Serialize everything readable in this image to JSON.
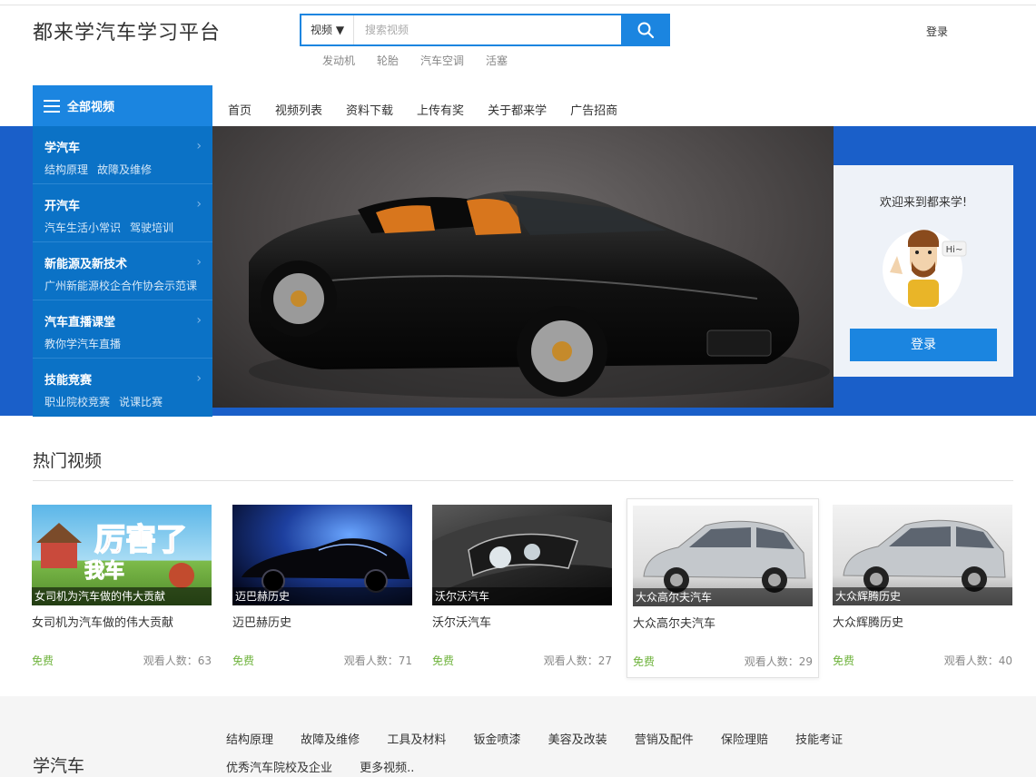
{
  "logo": "都来学汽车学习平台",
  "search": {
    "type_label": "视频 ▼",
    "placeholder": "搜索视频",
    "hot_words": [
      "发动机",
      "轮胎",
      "汽车空调",
      "活塞"
    ]
  },
  "header_login": "登录",
  "all_videos_label": "全部视频",
  "nav": [
    "首页",
    "视频列表",
    "资料下载",
    "上传有奖",
    "关于都来学",
    "广告招商"
  ],
  "side_menu": [
    {
      "title": "学汽车",
      "subs": [
        "结构原理",
        "故障及维修"
      ]
    },
    {
      "title": "开汽车",
      "subs": [
        "汽车生活小常识",
        "驾驶培训"
      ]
    },
    {
      "title": "新能源及新技术",
      "subs": [
        "广州新能源校企合作协会示范课"
      ]
    },
    {
      "title": "汽车直播课堂",
      "subs": [
        "教你学汽车直播"
      ]
    },
    {
      "title": "技能竞赛",
      "subs": [
        "职业院校竞赛",
        "说课比赛"
      ]
    }
  ],
  "welcome": {
    "text": "欢迎来到都来学!",
    "hi": "Hi~",
    "button": "登录"
  },
  "hot_section_title": "热门视频",
  "videos": [
    {
      "caption": "女司机为汽车做的伟大贡献",
      "title": "女司机为汽车做的伟大贡献",
      "price": "免费",
      "views": "观看人数：63"
    },
    {
      "caption": "迈巴赫历史",
      "title": "迈巴赫历史",
      "price": "免费",
      "views": "观看人数：71"
    },
    {
      "caption": "沃尔沃汽车",
      "title": "沃尔沃汽车",
      "price": "免费",
      "views": "观看人数：27"
    },
    {
      "caption": "大众高尔夫汽车",
      "title": "大众高尔夫汽车",
      "price": "免费",
      "views": "观看人数：29"
    },
    {
      "caption": "大众辉腾历史",
      "title": "大众辉腾历史",
      "price": "免费",
      "views": "观看人数：40"
    }
  ],
  "footer": {
    "title": "学汽车",
    "links": [
      "结构原理",
      "故障及维修",
      "工具及材料",
      "钣金喷漆",
      "美容及改装",
      "营销及配件",
      "保险理赔",
      "技能考证",
      "优秀汽车院校及企业",
      "更多视频.."
    ]
  },
  "colors": {
    "primary": "#1b85e0",
    "side_menu": "#0b72c6",
    "banner_bg": "#1a5fc9",
    "free": "#6fb33d"
  }
}
